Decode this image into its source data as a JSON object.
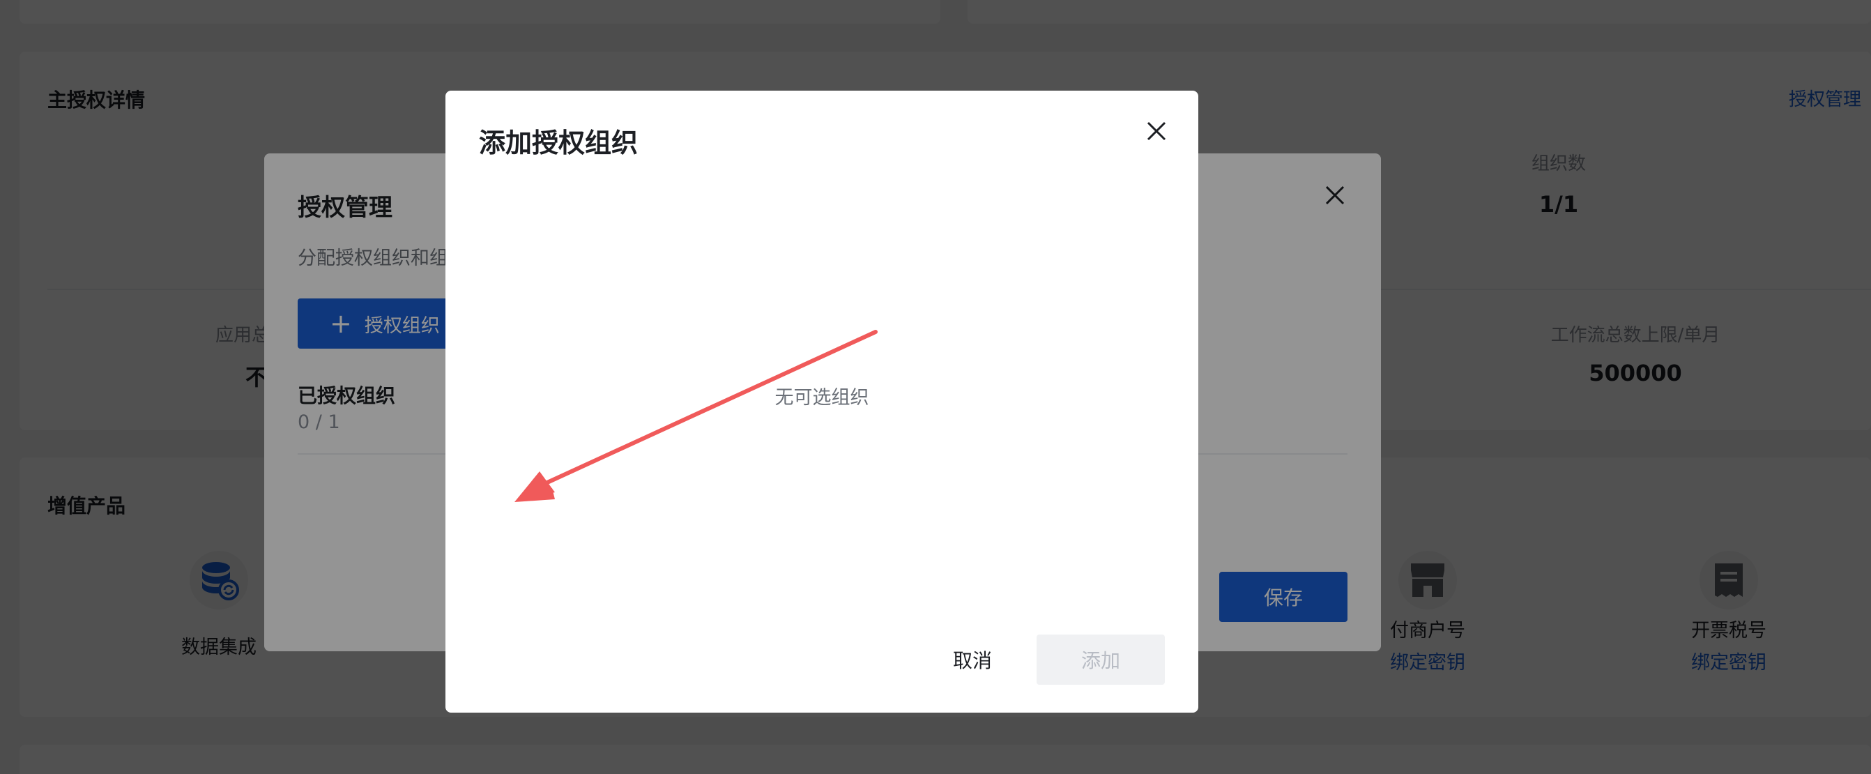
{
  "main_auth": {
    "title": "主授权详情",
    "manage_link": "授权管理",
    "stats": [
      {
        "label": "组织数",
        "value": "1/1"
      },
      {
        "label": "应用总",
        "value": "不"
      },
      {
        "label": "工作流总数上限/单月",
        "value": "500000"
      }
    ]
  },
  "value_added": {
    "title": "增值产品",
    "products": [
      {
        "label": "数据集成",
        "icon": "database-sync-icon"
      },
      {
        "label": "付商户号",
        "link": "绑定密钥",
        "icon": "store-icon"
      },
      {
        "label": "开票税号",
        "link": "绑定密钥",
        "icon": "receipt-icon"
      }
    ]
  },
  "auth_manage_dialog": {
    "title": "授权管理",
    "description": "分配授权组织和组",
    "add_button": "授权组织",
    "section_title": "已授权组织",
    "section_count": "0 / 1",
    "save_button": "保存"
  },
  "add_org_dialog": {
    "title": "添加授权组织",
    "empty_text": "无可选组织",
    "cancel_button": "取消",
    "confirm_button": "添加"
  },
  "colors": {
    "primary": "#1a5fd6",
    "annotation_arrow": "#f05a5a"
  }
}
